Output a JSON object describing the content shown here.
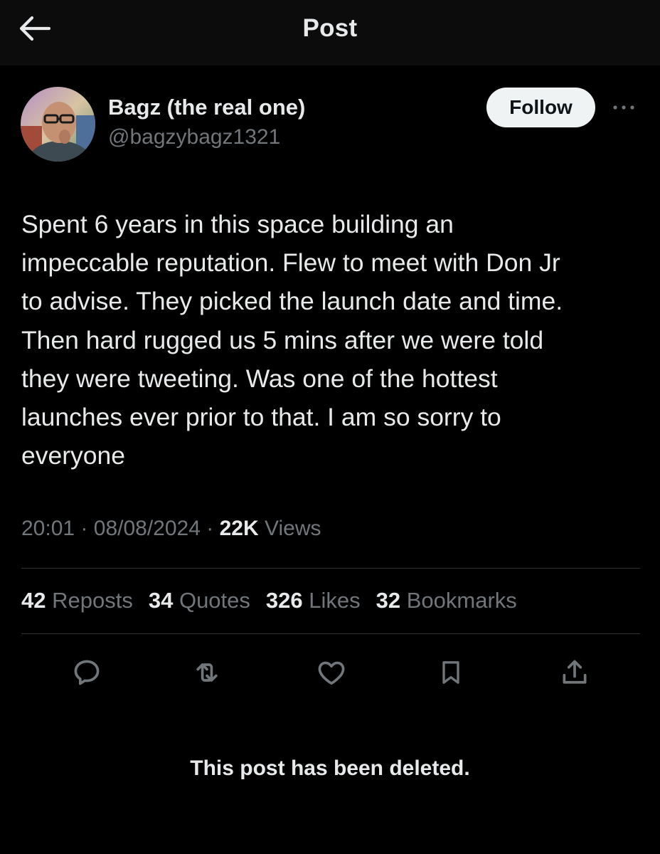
{
  "header": {
    "title": "Post",
    "back_icon": "arrow-left-icon"
  },
  "author": {
    "display_name": "Bagz (the real one)",
    "handle": "@bagzybagz1321",
    "follow_label": "Follow",
    "more_icon": "more-dots-icon"
  },
  "post": {
    "text": "Spent 6 years in this space building an\nimpeccable reputation. Flew to meet with Don Jr\nto advise. They picked the launch date and time.\nThen hard rugged us 5 mins after we were told\nthey were tweeting. Was one of the hottest\nlaunches ever prior to that. I am so sorry to\neveryone",
    "time": "20:01",
    "date": "08/08/2024",
    "views_count": "22K",
    "views_label": "Views",
    "separator": "·"
  },
  "stats": [
    {
      "count": "42",
      "label": "Reposts"
    },
    {
      "count": "34",
      "label": "Quotes"
    },
    {
      "count": "326",
      "label": "Likes"
    },
    {
      "count": "32",
      "label": "Bookmarks"
    }
  ],
  "actions": [
    "reply-icon",
    "repost-icon",
    "like-icon",
    "bookmark-icon",
    "share-icon"
  ],
  "notice": "This post has been deleted.",
  "colors": {
    "background": "#000000",
    "header_bg": "#0c0c0c",
    "text": "#e7e9ea",
    "secondary_text": "#71767b",
    "divider": "#2f3336",
    "follow_button_bg": "#eff3f4"
  }
}
